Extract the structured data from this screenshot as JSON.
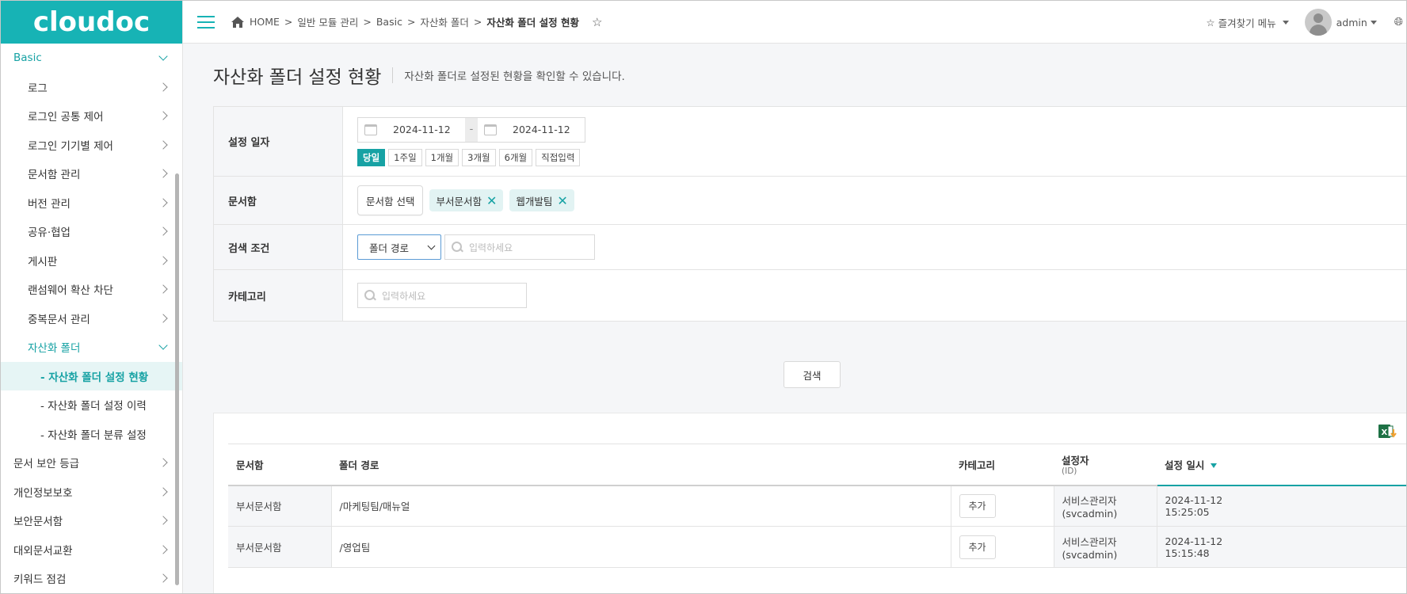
{
  "brand": {
    "logo": "cloudoc"
  },
  "sidebar": {
    "items": [
      {
        "label": "Basic",
        "level": 0,
        "state": "open"
      },
      {
        "label": "로그",
        "level": 1
      },
      {
        "label": "로그인 공통 제어",
        "level": 1
      },
      {
        "label": "로그인 기기별 제어",
        "level": 1
      },
      {
        "label": "문서함 관리",
        "level": 1
      },
      {
        "label": "버전 관리",
        "level": 1
      },
      {
        "label": "공유·협업",
        "level": 1
      },
      {
        "label": "게시판",
        "level": 1
      },
      {
        "label": "랜섬웨어 확산 차단",
        "level": 1
      },
      {
        "label": "중복문서 관리",
        "level": 1
      },
      {
        "label": "자산화 폴더",
        "level": 1,
        "state": "open"
      },
      {
        "label": "- 자산화 폴더 설정 현황",
        "level": 2,
        "state": "active"
      },
      {
        "label": "- 자산화 폴더 설정 이력",
        "level": 2
      },
      {
        "label": "- 자산화 폴더 분류 설정",
        "level": 2
      },
      {
        "label": "문서 보안 등급",
        "level": 0
      },
      {
        "label": "개인정보보호",
        "level": 0
      },
      {
        "label": "보안문서함",
        "level": 0
      },
      {
        "label": "대외문서교환",
        "level": 0
      },
      {
        "label": "키워드 점검",
        "level": 0
      }
    ]
  },
  "header": {
    "breadcrumb": [
      "HOME",
      "일반 모듈 관리",
      "Basic",
      "자산화 폴더",
      "자산화 폴더 설정 현황"
    ],
    "favorites_label": "즐겨찾기 메뉴",
    "user_name": "admin"
  },
  "page": {
    "title": "자산화 폴더 설정 현황",
    "description": "자산화 폴더로 설정된 현황을 확인할 수 있습니다."
  },
  "filter": {
    "date": {
      "label": "설정 일자",
      "from": "2024-11-12",
      "to": "2024-11-12",
      "separator": "-",
      "quick_ranges": [
        "당일",
        "1주일",
        "1개월",
        "3개월",
        "6개월",
        "직접입력"
      ],
      "selected_quick": "당일"
    },
    "box": {
      "label": "문서함",
      "select_button": "문서함 선택",
      "tags": [
        "부서문서함",
        "웹개발팀"
      ]
    },
    "condition": {
      "label": "검색 조건",
      "select_value": "폴더 경로",
      "placeholder": "입력하세요"
    },
    "category": {
      "label": "카테고리",
      "placeholder": "입력하세요"
    },
    "search_button": "검색"
  },
  "table": {
    "columns": {
      "box": "문서함",
      "path": "폴더 경로",
      "category": "카테고리",
      "setter": "설정자",
      "setter_sub": "(ID)",
      "date": "설정 일시"
    },
    "add_label": "추가",
    "rows": [
      {
        "box": "부서문서함",
        "path": "/마케팅팀/매뉴얼",
        "setter": "서비스관리자",
        "setter_id": "(svcadmin)",
        "date": "2024-11-12",
        "time": "15:25:05"
      },
      {
        "box": "부서문서함",
        "path": "/영업팀",
        "setter": "서비스관리자",
        "setter_id": "(svcadmin)",
        "date": "2024-11-12",
        "time": "15:15:48"
      }
    ]
  },
  "colors": {
    "brand": "#17b3b5",
    "accent": "#17a2a4",
    "excel_green": "#1e7145"
  }
}
